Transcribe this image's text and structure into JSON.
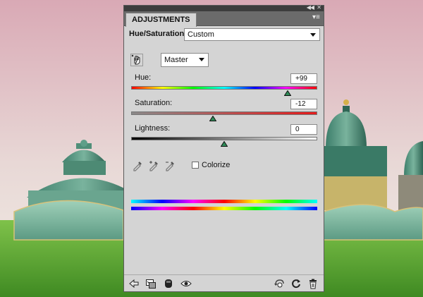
{
  "panel": {
    "tab_label": "ADJUSTMENTS",
    "header_label": "Hue/Saturation",
    "preset_value": "Custom",
    "channel_value": "Master"
  },
  "sliders": {
    "hue": {
      "label": "Hue:",
      "value": "+99",
      "fraction": 0.84
    },
    "saturation": {
      "label": "Saturation:",
      "value": "-12",
      "fraction": 0.44
    },
    "lightness": {
      "label": "Lightness:",
      "value": "0",
      "fraction": 0.5
    }
  },
  "options": {
    "colorize_label": "Colorize",
    "colorize_checked": false
  },
  "icons": {
    "titlebar": [
      "collapse-icon",
      "close-icon",
      "panel-menu-icon"
    ],
    "tools": [
      "target-adjust-hand-icon",
      "eyedropper-icon",
      "eyedropper-plus-icon",
      "eyedropper-minus-icon"
    ],
    "footer": [
      "back-arrow-icon",
      "clip-to-layer-icon",
      "mask-icon",
      "visibility-eye-icon",
      "view-previous-icon",
      "reset-icon",
      "trash-icon"
    ]
  },
  "colors": {
    "panel_bg": "#d4d4d4",
    "title_bar": "#3d3d3d",
    "tab_row": "#6b6b6b",
    "thumb_green": "#2e8b57"
  }
}
